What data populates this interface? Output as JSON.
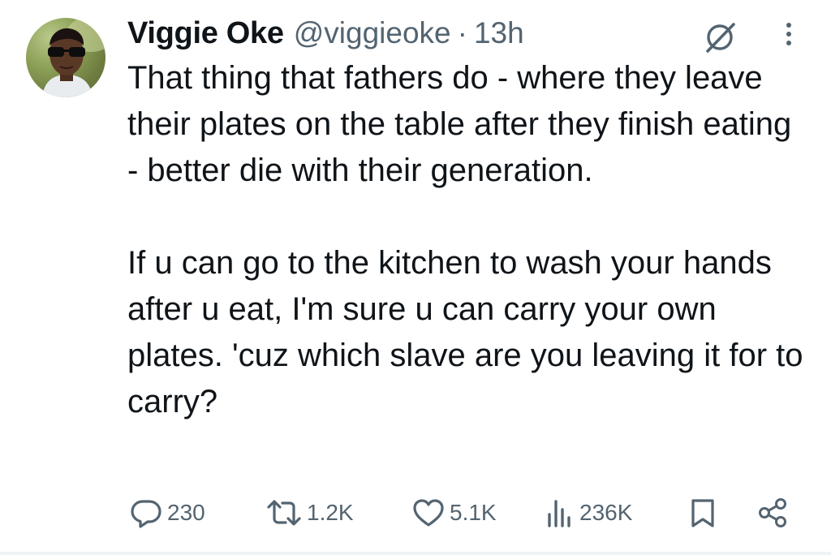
{
  "tweet": {
    "author_name": "Viggie Oke",
    "handle": "@viggieoke",
    "separator": "·",
    "time": "13h",
    "paragraph_1": "That thing that fathers do - where they leave their plates on the table after they finish eating - better die with their generation.",
    "paragraph_2": "If u can go to the kitchen to wash your hands after u eat, I'm sure u can carry your own plates. 'cuz which slave are you leaving it for to carry?"
  },
  "actions": {
    "replies": "230",
    "reposts": "1.2K",
    "likes": "5.1K",
    "views": "236K"
  },
  "icons": {
    "reply": "reply-icon",
    "repost": "repost-icon",
    "like": "heart-icon",
    "views": "views-icon",
    "bookmark": "bookmark-icon",
    "share": "share-icon",
    "grok": "grok-icon",
    "more": "more-icon"
  },
  "colors": {
    "text": "#0f1419",
    "secondary": "#536471",
    "background": "#ffffff"
  }
}
